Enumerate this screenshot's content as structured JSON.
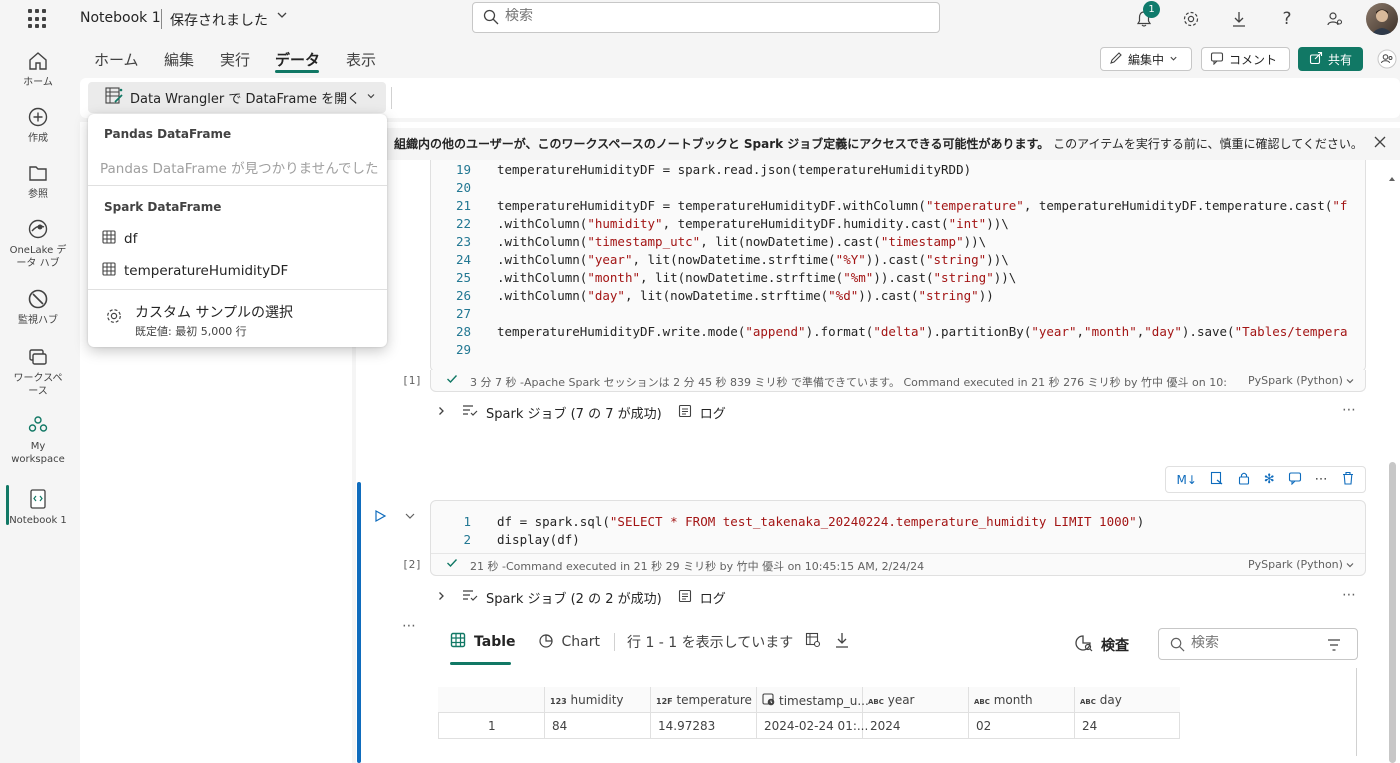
{
  "topbar": {
    "notebook_title": "Notebook 1",
    "save_status": "保存されました",
    "search_placeholder": "検索",
    "notification_count": "1"
  },
  "leftrail": {
    "items": [
      {
        "label": "ホーム",
        "icon": "home-icon"
      },
      {
        "label": "作成",
        "icon": "plus-circle-icon"
      },
      {
        "label": "参照",
        "icon": "folder-icon"
      },
      {
        "label": "OneLake データ ハブ",
        "label_line1": "OneLake デ",
        "label_line2": "ータ ハブ",
        "icon": "onelake-icon"
      },
      {
        "label": "監視ハブ",
        "icon": "monitor-icon"
      },
      {
        "label": "ワークスペース",
        "label_line1": "ワークスペ",
        "label_line2": "ース",
        "icon": "workspaces-icon"
      },
      {
        "label": "My workspace",
        "label_line1": "My",
        "label_line2": "workspace",
        "icon": "my-workspace-icon"
      },
      {
        "label": "Notebook 1",
        "icon": "notebook-icon"
      }
    ]
  },
  "ribbon": {
    "tabs": [
      "ホーム",
      "編集",
      "実行",
      "データ",
      "表示"
    ],
    "active_tab": "データ",
    "editing_label": "編集中",
    "comment_label": "コメント",
    "share_label": "共有"
  },
  "toolbar": {
    "data_wrangler_label": "Data Wrangler で DataFrame を開く"
  },
  "dropdown": {
    "pandas_header": "Pandas DataFrame",
    "pandas_empty": "Pandas DataFrame が見つかりませんでした",
    "spark_header": "Spark DataFrame",
    "spark_items": [
      "df",
      "temperatureHumidityDF"
    ],
    "custom_sample_label": "カスタム サンプルの選択",
    "custom_sample_default": "既定値: 最初 5,000 行"
  },
  "infobar": {
    "bold_text": "組織内の他のユーザーが、このワークスペースのノートブックと Spark ジョブ定義にアクセスできる可能性があります。",
    "normal_text": "このアイテムを実行する前に、慎重に確認してください。"
  },
  "cell1": {
    "lines": [
      {
        "n": "19",
        "code": "temperatureHumidityDF = spark.read.json(temperatureHumidityRDD)"
      },
      {
        "n": "20",
        "code": ""
      },
      {
        "n": "21",
        "code": "temperatureHumidityDF = temperatureHumidityDF.withColumn(\"temperature\", temperatureHumidityDF.temperature.cast(\"f"
      },
      {
        "n": "22",
        "code": ".withColumn(\"humidity\", temperatureHumidityDF.humidity.cast(\"int\"))\\"
      },
      {
        "n": "23",
        "code": ".withColumn(\"timestamp_utc\", lit(nowDatetime).cast(\"timestamp\"))\\"
      },
      {
        "n": "24",
        "code": ".withColumn(\"year\", lit(nowDatetime.strftime(\"%Y\")).cast(\"string\"))\\"
      },
      {
        "n": "25",
        "code": ".withColumn(\"month\", lit(nowDatetime.strftime(\"%m\")).cast(\"string\"))\\"
      },
      {
        "n": "26",
        "code": ".withColumn(\"day\", lit(nowDatetime.strftime(\"%d\")).cast(\"string\"))"
      },
      {
        "n": "27",
        "code": ""
      },
      {
        "n": "28",
        "code": "temperatureHumidityDF.write.mode(\"append\").format(\"delta\").partitionBy(\"year\",\"month\",\"day\").save(\"Tables/tempera"
      },
      {
        "n": "29",
        "code": ""
      }
    ],
    "exec_index": "[1]",
    "status": "3 分 7 秒 -Apache Spark セッションは 2 分 45 秒 839 ミリ秒 で準備できています。 Command executed in 21 秒 276 ミリ秒 by 竹中 優斗 on 10:",
    "language": "PySpark (Python)",
    "jobs_label": "Spark ジョブ (7 の 7 が成功)",
    "log_label": "ログ"
  },
  "cell2": {
    "lines": [
      {
        "n": "1",
        "code": "df = spark.sql(\"SELECT * FROM test_takenaka_20240224.temperature_humidity LIMIT 1000\")"
      },
      {
        "n": "2",
        "code": "display(df)"
      }
    ],
    "exec_index": "[2]",
    "status": "21 秒 -Command executed in 21 秒 29 ミリ秒 by 竹中 優斗 on 10:45:15 AM, 2/24/24",
    "language": "PySpark (Python)",
    "jobs_label": "Spark ジョブ (2 の 2 が成功)",
    "log_label": "ログ"
  },
  "output": {
    "table_tab": "Table",
    "chart_tab": "Chart",
    "rows_info": "行 1 - 1 を表示しています",
    "inspect_label": "検査",
    "search_placeholder": "検索",
    "columns": [
      {
        "type": "123",
        "name": "humidity"
      },
      {
        "type": "12F",
        "name": "temperature"
      },
      {
        "type": "clock",
        "name": "timestamp_u..."
      },
      {
        "type": "ABC",
        "name": "year"
      },
      {
        "type": "ABC",
        "name": "month"
      },
      {
        "type": "ABC",
        "name": "day"
      }
    ],
    "rows": [
      {
        "idx": "1",
        "humidity": "84",
        "temperature": "14.97283",
        "timestamp": "2024-02-24 01:...",
        "year": "2024",
        "month": "02",
        "day": "24"
      }
    ]
  },
  "colors": {
    "accent": "#117865",
    "link_blue": "#0f6cbd"
  }
}
